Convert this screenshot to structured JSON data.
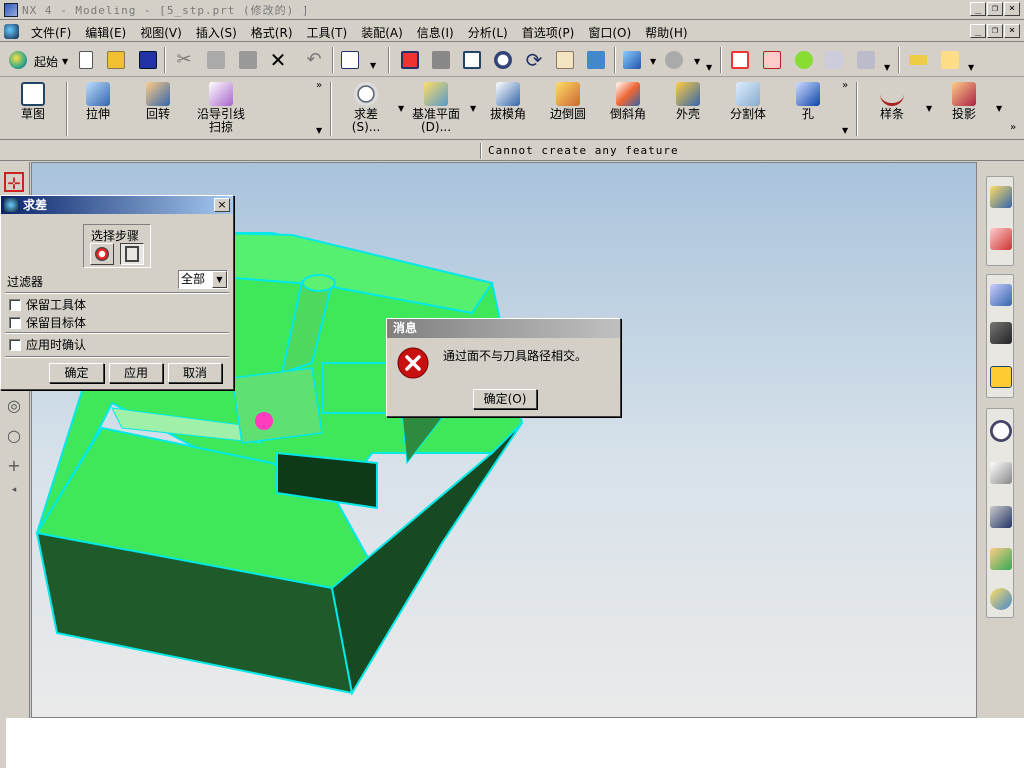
{
  "window": {
    "title": "NX 4 - Modeling - [5_stp.prt (修改的) ]",
    "min": "_",
    "restore": "❐",
    "close": "×"
  },
  "menu": [
    "文件(F)",
    "编辑(E)",
    "视图(V)",
    "插入(S)",
    "格式(R)",
    "工具(T)",
    "装配(A)",
    "信息(I)",
    "分析(L)",
    "首选项(P)",
    "窗口(O)",
    "帮助(H)"
  ],
  "toolbar": {
    "start_label": "起始"
  },
  "feature_toolbar": {
    "items": [
      "草图",
      "拉伸",
      "回转",
      "沿导引线",
      "扫掠",
      "求差",
      "(S)...",
      "基准平面",
      "(D)...",
      "拔模角",
      "边倒圆",
      "倒斜角",
      "外壳",
      "分割体",
      "孔",
      "样条",
      "投影"
    ]
  },
  "status": {
    "text": "Cannot create any feature"
  },
  "subtract_dialog": {
    "title": "求差",
    "close": "×",
    "steps_label": "选择步骤",
    "filter_label": "过滤器",
    "filter_value": "全部",
    "keep_tool": "保留工具体",
    "keep_target": "保留目标体",
    "confirm_on_apply": "应用时确认",
    "ok": "确定",
    "apply": "应用",
    "cancel": "取消"
  },
  "message_box": {
    "title": "消息",
    "text": "通过面不与刀具路径相交。",
    "ok": "确定(O)"
  },
  "colors": {
    "model_light": "#3ee85a",
    "model_dark": "#1f5a2a",
    "edge": "#00e8e8",
    "title_active": "#0a246a"
  }
}
